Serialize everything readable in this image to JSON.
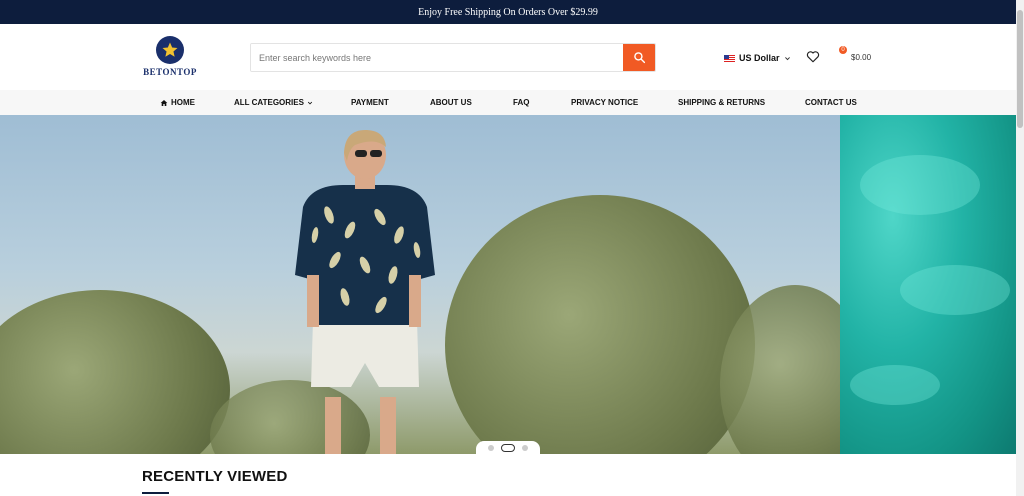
{
  "promo_bar": {
    "text": "Enjoy Free Shipping On Orders Over $29.99"
  },
  "logo": {
    "text": "BETONTOP"
  },
  "search": {
    "placeholder": "Enter search keywords here",
    "button_icon": "search-icon"
  },
  "currency": {
    "label": "US Dollar",
    "flag_icon": "us-flag-icon"
  },
  "wishlist": {
    "icon": "heart-icon"
  },
  "cart": {
    "icon": "cart-icon",
    "count": "0",
    "total": "$0.00"
  },
  "nav": {
    "items": [
      {
        "label": "HOME",
        "icon": "home-icon"
      },
      {
        "label": "ALL CATEGORIES",
        "icon": "chevron-down-icon"
      },
      {
        "label": "PAYMENT"
      },
      {
        "label": "ABOUT US"
      },
      {
        "label": "FAQ"
      },
      {
        "label": "PRIVACY NOTICE"
      },
      {
        "label": "SHIPPING & RETURNS"
      },
      {
        "label": "CONTACT US"
      }
    ]
  },
  "hero": {
    "slide_count": 3,
    "active_slide": 2
  },
  "recently_viewed": {
    "title": "RECENTLY VIEWED"
  },
  "colors": {
    "navy": "#0d1d3d",
    "accent": "#f15a24",
    "nav_bg": "#f7f7f7"
  }
}
